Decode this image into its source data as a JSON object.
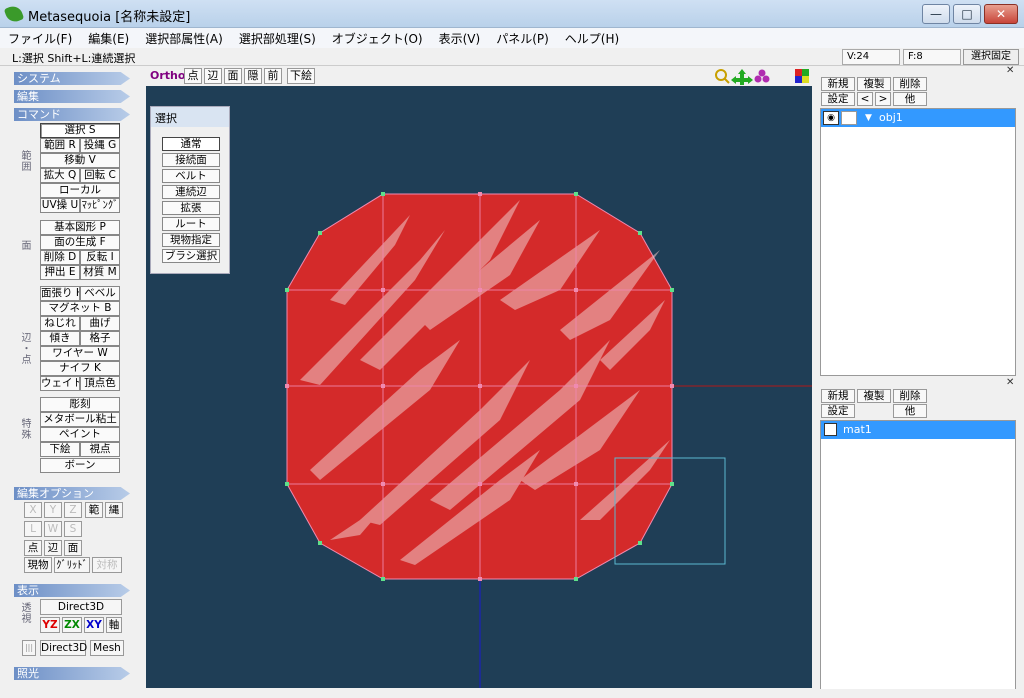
{
  "window": {
    "title": "Metasequoia [名称未設定]",
    "minimize_label": "—",
    "maximize_label": "□",
    "close_label": "✕"
  },
  "menu": [
    "ファイル(F)",
    "編集(E)",
    "選択部属性(A)",
    "選択部処理(S)",
    "オブジェクト(O)",
    "表示(V)",
    "パネル(P)",
    "ヘルプ(H)"
  ],
  "status": {
    "hint": "L:選択  Shift+L:連続選択",
    "vertices": "V:24",
    "faces": "F:8",
    "lock_button": "選択固定"
  },
  "left_panel": {
    "section_system": "システム",
    "section_edit": "編集",
    "section_command": "コマンド",
    "group_range": "範囲",
    "cmd_select": "選択 S",
    "cmd_range": "範囲 R",
    "cmd_lasso": "投縄 G",
    "cmd_move": "移動 V",
    "cmd_scale": "拡大 Q",
    "cmd_rotate": "回転 C",
    "cmd_local": "ローカル",
    "cmd_uv": "UV操 U",
    "cmd_mapping": "ﾏｯﾋﾟﾝｸﾞ",
    "group_face": "面",
    "cmd_primitive": "基本図形 P",
    "cmd_face_gen": "面の生成 F",
    "cmd_delete": "削除 D",
    "cmd_flip": "反転 I",
    "cmd_extrude": "押出 E",
    "cmd_material": "材質 M",
    "group_edge": "辺・点",
    "cmd_face_stretch": "面張り H",
    "cmd_bevel": "ベベル",
    "cmd_magnet": "マグネット B",
    "cmd_twist": "ねじれ",
    "cmd_bend": "曲げ",
    "cmd_tilt": "傾き",
    "cmd_lattice": "格子",
    "cmd_wire": "ワイヤー W",
    "cmd_knife": "ナイフ K",
    "cmd_weight": "ウェイト",
    "cmd_vcolor": "頂点色",
    "group_special": "特殊",
    "cmd_sculpt": "彫刻",
    "cmd_metaball": "メタボール粘土",
    "cmd_paint": "ペイント",
    "cmd_underlay": "下絵",
    "cmd_viewpoint": "視点",
    "cmd_bone": "ボーン",
    "section_edit_option": "編集オプション",
    "opt_x": "X",
    "opt_y": "Y",
    "opt_z": "Z",
    "opt_range": "範",
    "opt_lasso": "縄",
    "opt_l": "L",
    "opt_w": "W",
    "opt_s": "S",
    "opt_point": "点",
    "opt_edge": "辺",
    "opt_face": "面",
    "opt_current": "現物",
    "opt_grid": "ｸﾞﾘｯﾄﾞ",
    "opt_symmetry": "対称",
    "section_display": "表示",
    "group_perspective": "透視",
    "disp_direct3d_top": "Direct3D",
    "disp_yz": "YZ",
    "disp_zx": "ZX",
    "disp_xy": "XY",
    "disp_axis": "軸",
    "disp_sep": "|||",
    "disp_direct3d_bottom": "Direct3D",
    "disp_mesh": "Mesh",
    "section_lighting": "照光"
  },
  "view_toolbar": {
    "ortho": "Ortho",
    "point": "点",
    "edge": "辺",
    "face": "面",
    "hidden": "隠",
    "front": "前",
    "underlay": "下絵"
  },
  "select_popup": {
    "title": "選択",
    "items": [
      "通常",
      "接続面",
      "ベルト",
      "連続辺",
      "拡張",
      "ルート",
      "現物指定",
      "ブラシ選択"
    ]
  },
  "object_panel": {
    "new": "新規",
    "copy": "複製",
    "delete": "削除",
    "settings": "設定",
    "prev": "<",
    "next": ">",
    "other": "他",
    "objects": [
      "obj1"
    ]
  },
  "material_panel": {
    "new": "新規",
    "copy": "複製",
    "delete": "削除",
    "settings": "設定",
    "other": "他",
    "materials": [
      "mat1"
    ]
  },
  "colors": {
    "viewport_bg": "#1f3e56",
    "mesh_fill": "#d42a2a",
    "selection_blue": "#3399ff",
    "edge_pink": "#f08ab0",
    "vertex_green": "#5ee08a"
  }
}
